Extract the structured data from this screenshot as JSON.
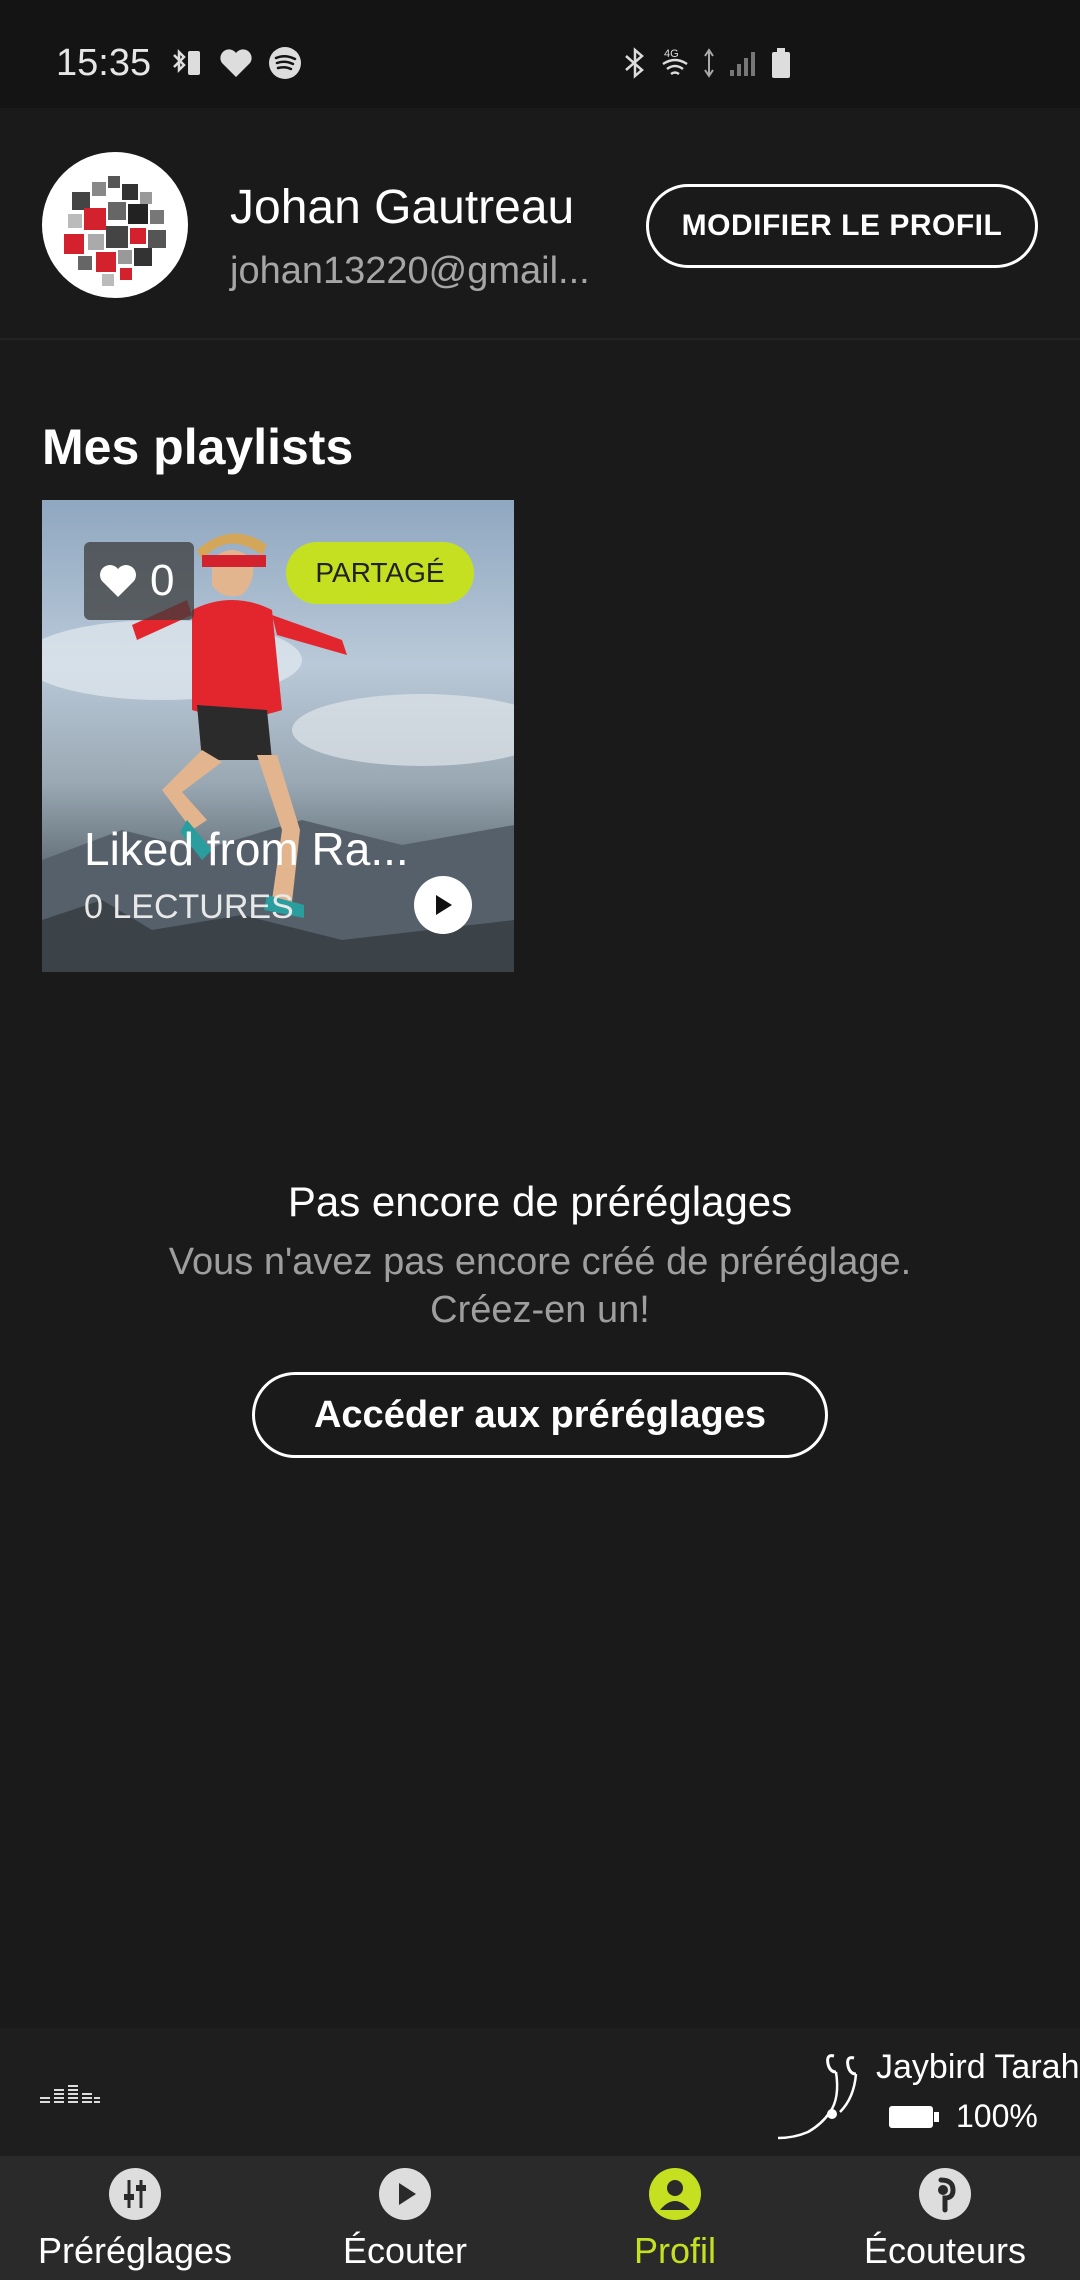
{
  "status_bar": {
    "time": "15:35"
  },
  "profile": {
    "name": "Johan Gautreau",
    "email": "johan13220@gmail...",
    "edit_button_label": "MODIFIER LE PROFIL"
  },
  "playlists": {
    "section_title": "Mes playlists",
    "items": [
      {
        "title": "Liked from Ra...",
        "plays": "0 LECTURES",
        "likes": "0",
        "shared_badge": "PARTAGÉ"
      }
    ]
  },
  "presets_empty": {
    "title": "Pas encore de préréglages",
    "description": "Vous n'avez pas encore créé de préréglage. Créez-en un!",
    "button_label": "Accéder aux préréglages"
  },
  "device": {
    "name": "Jaybird Tarah",
    "battery": "100%"
  },
  "nav": {
    "items": [
      {
        "label": "Préréglages",
        "icon": "sliders-icon"
      },
      {
        "label": "Écouter",
        "icon": "play-icon"
      },
      {
        "label": "Profil",
        "icon": "profile-icon"
      },
      {
        "label": "Écouteurs",
        "icon": "earbud-icon"
      }
    ],
    "active_index": 2
  },
  "colors": {
    "accent": "#c4e021",
    "background": "#1a1a1a",
    "nav_background": "#2a2a2a"
  }
}
